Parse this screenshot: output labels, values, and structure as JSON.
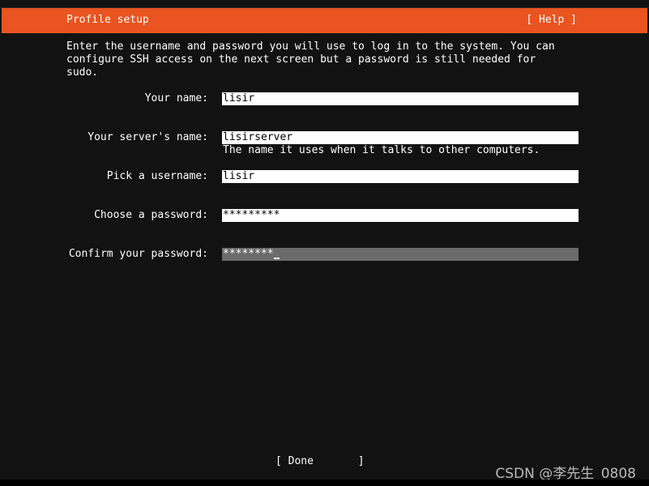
{
  "header": {
    "title": "Profile setup",
    "help_label": "[ Help ]"
  },
  "intro_text": "Enter the username and password you will use to log in to the system. You can\nconfigure SSH access on the next screen but a password is still needed for\nsudo.",
  "fields": {
    "your_name": {
      "label": "Your name:",
      "value": "lisir"
    },
    "server_name": {
      "label": "Your server's name:",
      "value": "lisirserver",
      "hint": "The name it uses when it talks to other computers."
    },
    "username": {
      "label": "Pick a username:",
      "value": "lisir"
    },
    "password": {
      "label": "Choose a password:",
      "value": "*********"
    },
    "confirm_password": {
      "label": "Confirm your password:",
      "value": "********"
    }
  },
  "done_label": "[ Done       ]",
  "watermark": "CSDN @李先生_0808",
  "colors": {
    "header_bg": "#e95420",
    "background": "#121212",
    "input_bg": "#ffffff",
    "focused_input_bg": "#6b6b6b"
  }
}
